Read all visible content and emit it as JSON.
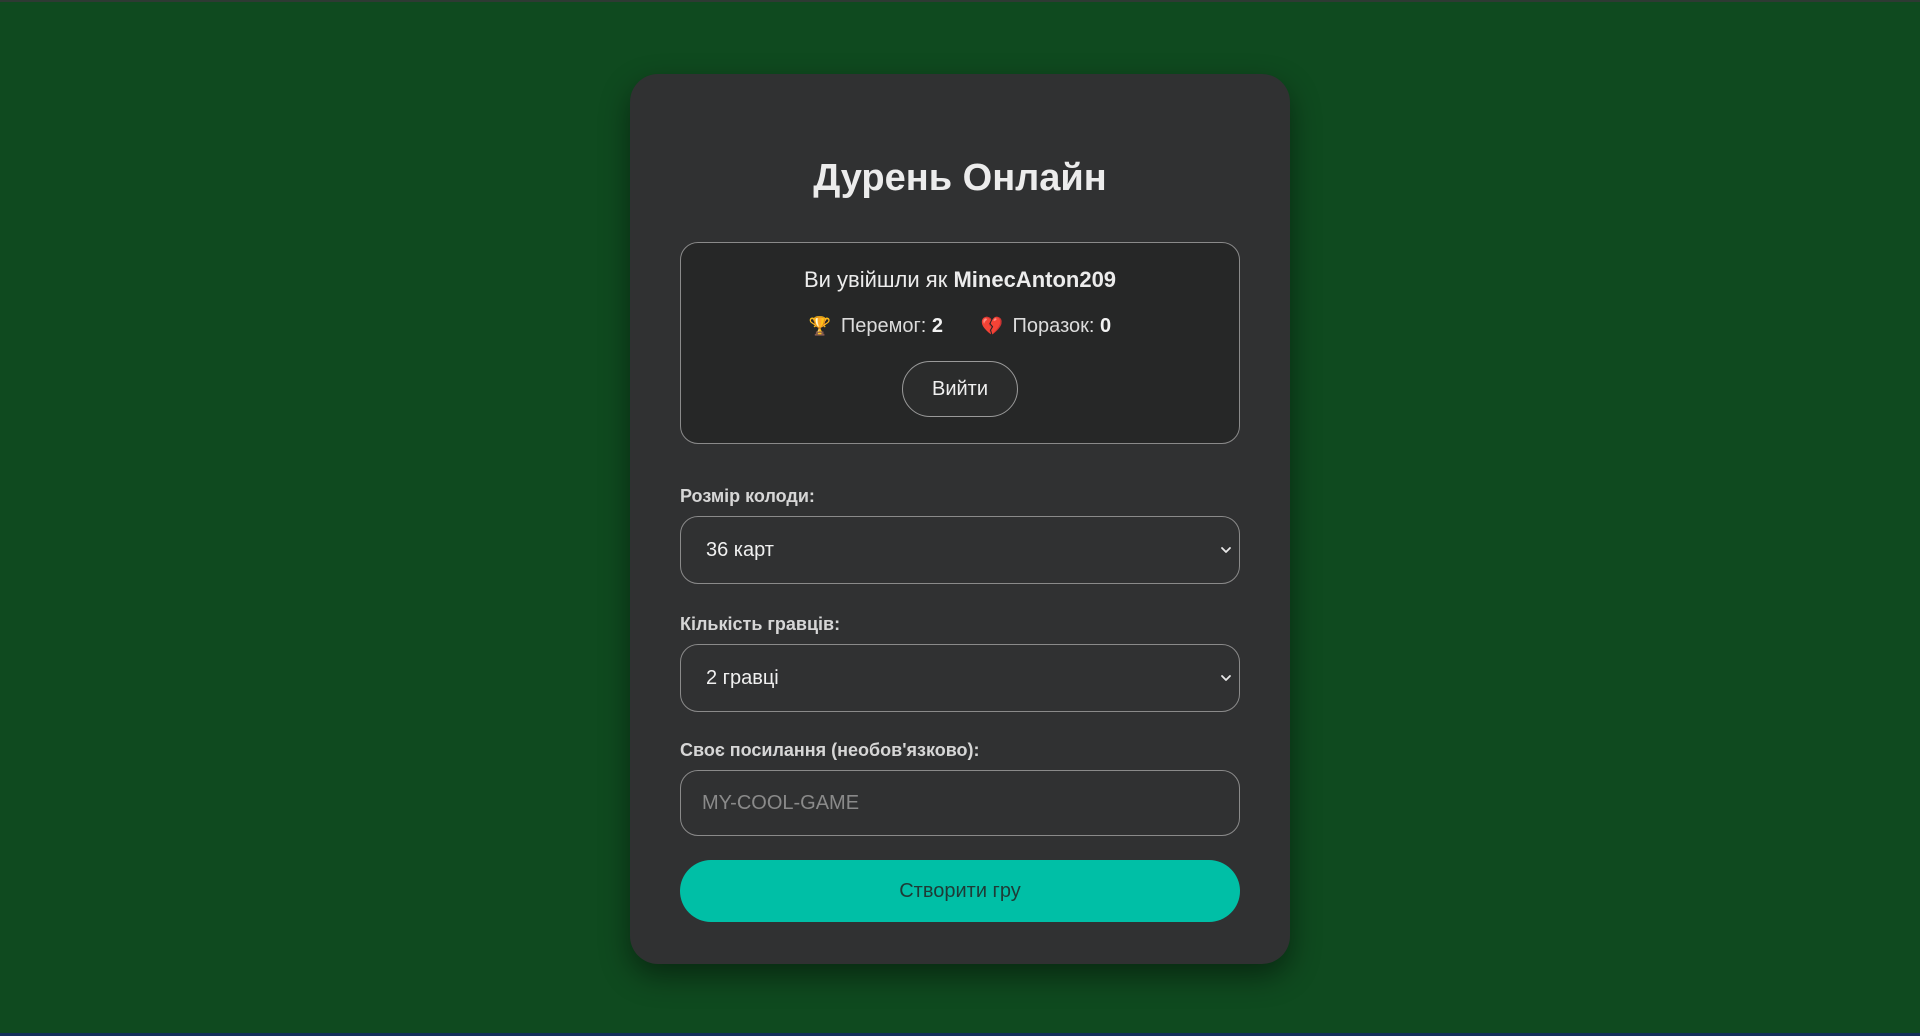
{
  "title": "Дурень Онлайн",
  "user": {
    "logged_in_prefix": "Ви увійшли як",
    "username": "MinecAnton209",
    "wins_label": "Перемог:",
    "wins": "2",
    "losses_label": "Поразок:",
    "losses": "0",
    "wins_icon": "🏆",
    "losses_icon": "💔",
    "logout_label": "Вийти"
  },
  "form": {
    "deck_label": "Розмір колоди:",
    "deck_value": "36 карт",
    "players_label": "Кількість гравців:",
    "players_value": "2 гравці",
    "link_label": "Своє посилання (необов'язково):",
    "link_placeholder": "MY-COOL-GAME",
    "create_label": "Створити гру"
  },
  "colors": {
    "background": "#0f4a1f",
    "card": "#303132",
    "accent": "#00bfa6"
  },
  "icons": {
    "wins": "trophy-icon",
    "losses": "broken-heart-icon",
    "select": "chevron-down-icon"
  }
}
